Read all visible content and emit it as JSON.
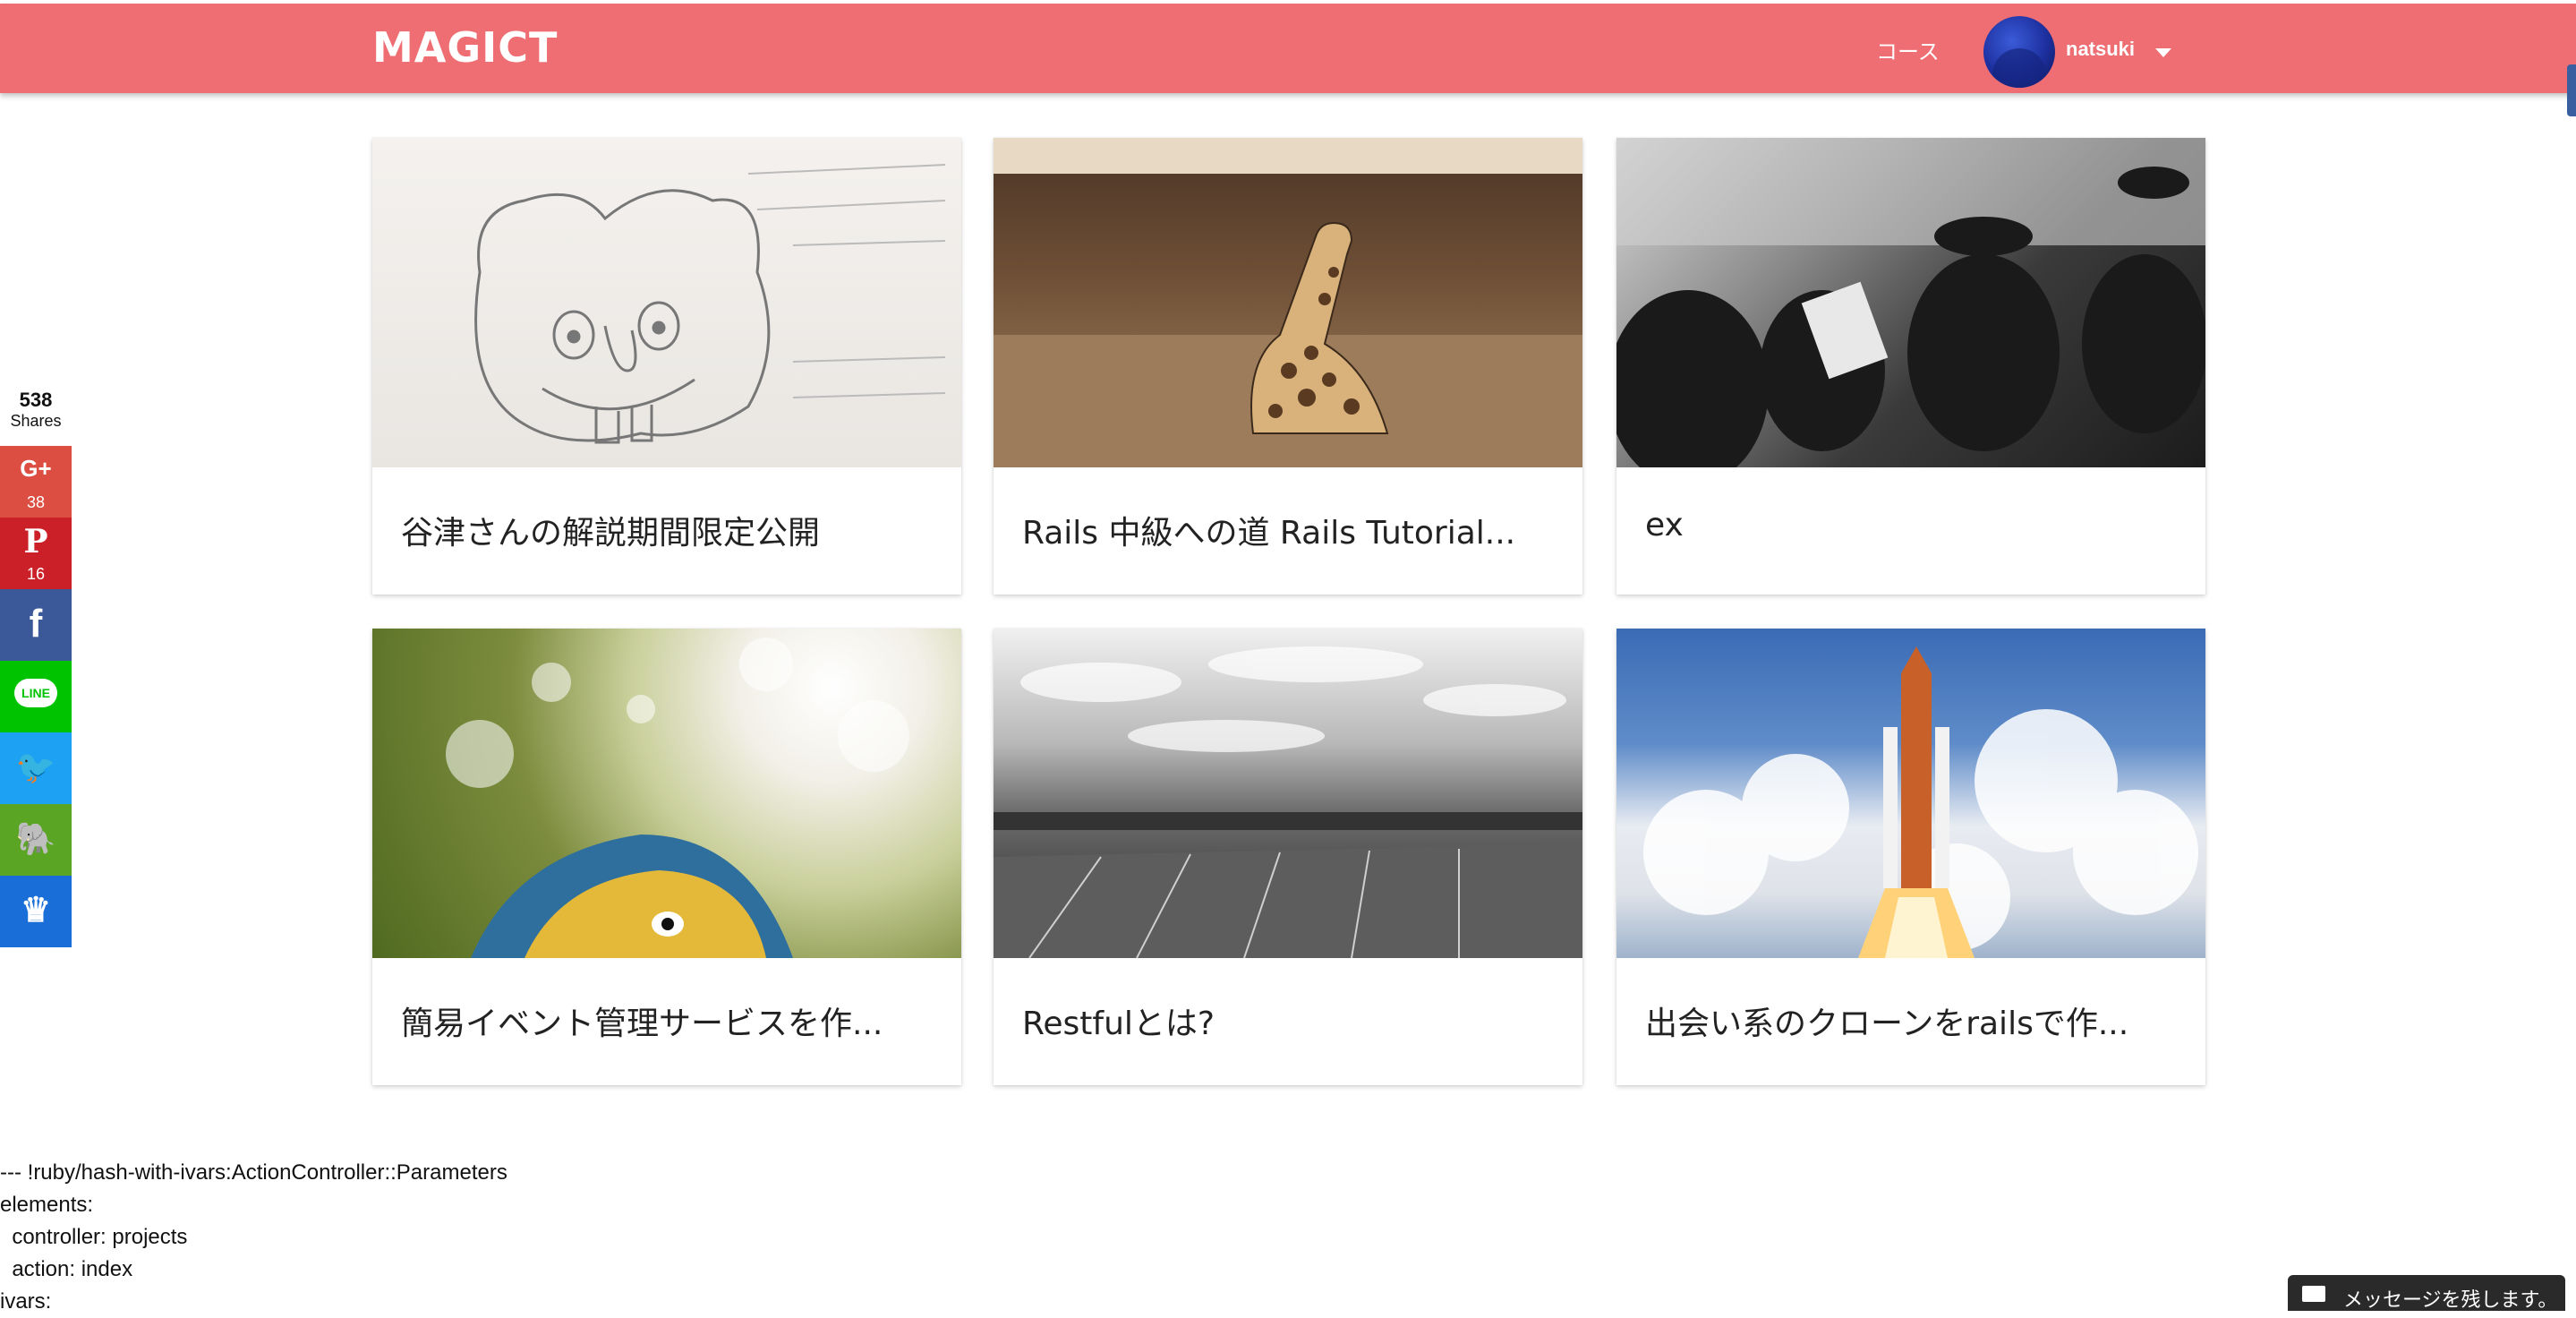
{
  "navbar": {
    "brand": "MAGICT",
    "course_link": "コース",
    "username": "natsuki",
    "accent_color": "#ef6e73"
  },
  "social": {
    "share_total": "538",
    "share_label": "Shares",
    "buttons": [
      {
        "name": "google-plus",
        "glyph": "G+",
        "count": "38",
        "color": "#dc4e41"
      },
      {
        "name": "pinterest",
        "glyph": "P",
        "count": "16",
        "color": "#cb2027"
      },
      {
        "name": "facebook",
        "glyph": "f",
        "color": "#3b5998"
      },
      {
        "name": "line",
        "glyph": "LINE",
        "color": "#00c300"
      },
      {
        "name": "twitter",
        "glyph": "🐦",
        "color": "#1da1f2"
      },
      {
        "name": "evernote",
        "glyph": "🐘",
        "color": "#5ba525"
      },
      {
        "name": "sumome",
        "glyph": "♛",
        "color": "#1a6ed8"
      }
    ]
  },
  "projects": [
    {
      "title": "谷津さんの解説期間限定公開",
      "thumb": "sketch"
    },
    {
      "title": "Rails 中級への道 Rails Tutorial...",
      "thumb": "giraffe"
    },
    {
      "title": "ex",
      "thumb": "crowd"
    },
    {
      "title": "簡易イベント管理サービスを作...",
      "thumb": "parrot"
    },
    {
      "title": "Restfulとは?",
      "thumb": "stadium"
    },
    {
      "title": "出会い系のクローンをrailsで作...",
      "thumb": "rocket"
    }
  ],
  "debug": {
    "line1": "--- !ruby/hash-with-ivars:ActionController::Parameters",
    "line2": "elements:",
    "line3": "  controller: projects",
    "line4": "  action: index",
    "line5": "ivars:"
  },
  "message_widget": {
    "label": "メッセージを残します。"
  }
}
